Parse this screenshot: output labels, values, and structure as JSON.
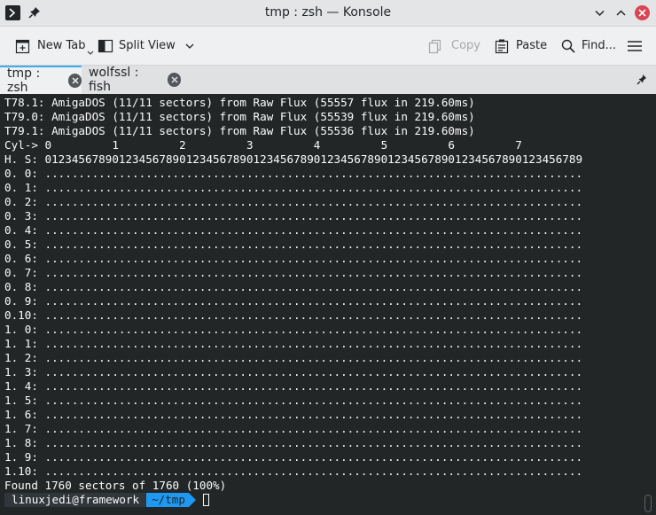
{
  "window": {
    "title": "tmp : zsh — Konsole",
    "icons": [
      "konsole-app-icon",
      "pin-icon",
      "minimize-icon",
      "maximize-icon",
      "close-icon"
    ]
  },
  "toolbar": {
    "new_tab": "New Tab",
    "split_view": "Split View",
    "copy": "Copy",
    "paste": "Paste",
    "find": "Find..."
  },
  "tabs": [
    {
      "label": "tmp : zsh",
      "active": true
    },
    {
      "label": "wolfssl : fish",
      "active": false
    }
  ],
  "terminal": {
    "lines": [
      "T78.1: AmigaDOS (11/11 sectors) from Raw Flux (55557 flux in 219.60ms)",
      "T79.0: AmigaDOS (11/11 sectors) from Raw Flux (55539 flux in 219.60ms)",
      "T79.1: AmigaDOS (11/11 sectors) from Raw Flux (55536 flux in 219.60ms)",
      "Cyl-> 0         1         2         3         4         5         6         7",
      "H. S: 01234567890123456789012345678901234567890123456789012345678901234567890123456789",
      "0. 0: ................................................................................",
      "0. 1: ................................................................................",
      "0. 2: ................................................................................",
      "0. 3: ................................................................................",
      "0. 4: ................................................................................",
      "0. 5: ................................................................................",
      "0. 6: ................................................................................",
      "0. 7: ................................................................................",
      "0. 8: ................................................................................",
      "0. 9: ................................................................................",
      "0.10: ................................................................................",
      "1. 0: ................................................................................",
      "1. 1: ................................................................................",
      "1. 2: ................................................................................",
      "1. 3: ................................................................................",
      "1. 4: ................................................................................",
      "1. 5: ................................................................................",
      "1. 6: ................................................................................",
      "1. 7: ................................................................................",
      "1. 8: ................................................................................",
      "1. 9: ................................................................................",
      "1.10: ................................................................................",
      "Found 1760 sectors of 1760 (100%)"
    ],
    "prompt_user": "linuxjedi@framework",
    "prompt_dir": "~/tmp"
  },
  "colors": {
    "terminal_bg": "#232627",
    "terminal_fg": "#fcfcfc",
    "accent": "#1d99f3",
    "close_button": "#da4453"
  }
}
